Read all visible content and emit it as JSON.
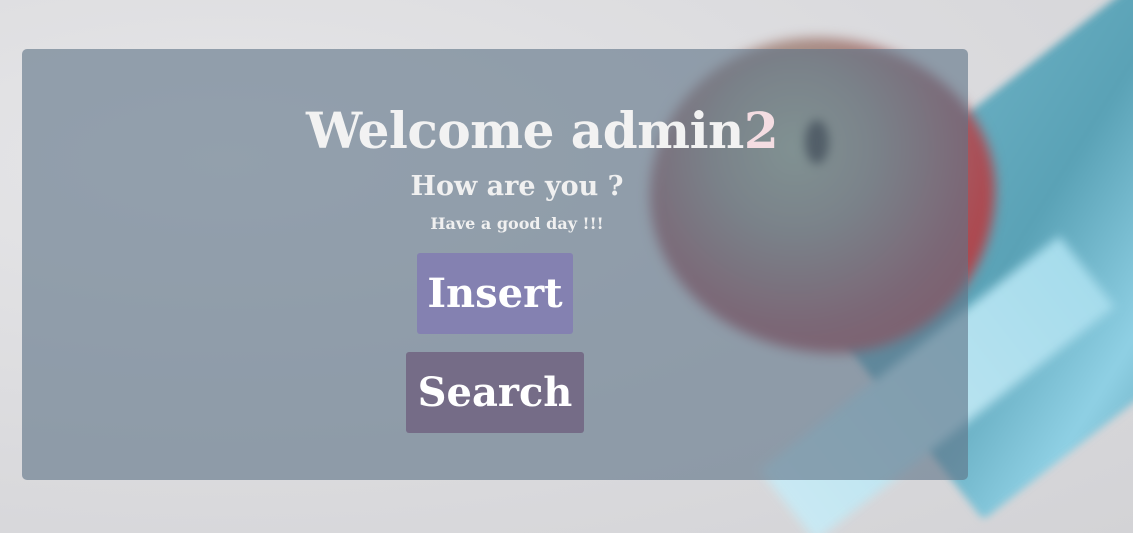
{
  "welcome": {
    "greeting": "Welcome admin",
    "user_suffix": "2",
    "subtitle": "How are you ?",
    "tagline": "Have a good day !!!"
  },
  "actions": {
    "insert_label": "Insert",
    "search_label": "Search"
  },
  "colors": {
    "panel_overlay": "#607588",
    "insert_button": "#8481b1",
    "search_button": "#756c87",
    "text": "#f2f2f2",
    "user_suffix": "#f4dde2"
  }
}
